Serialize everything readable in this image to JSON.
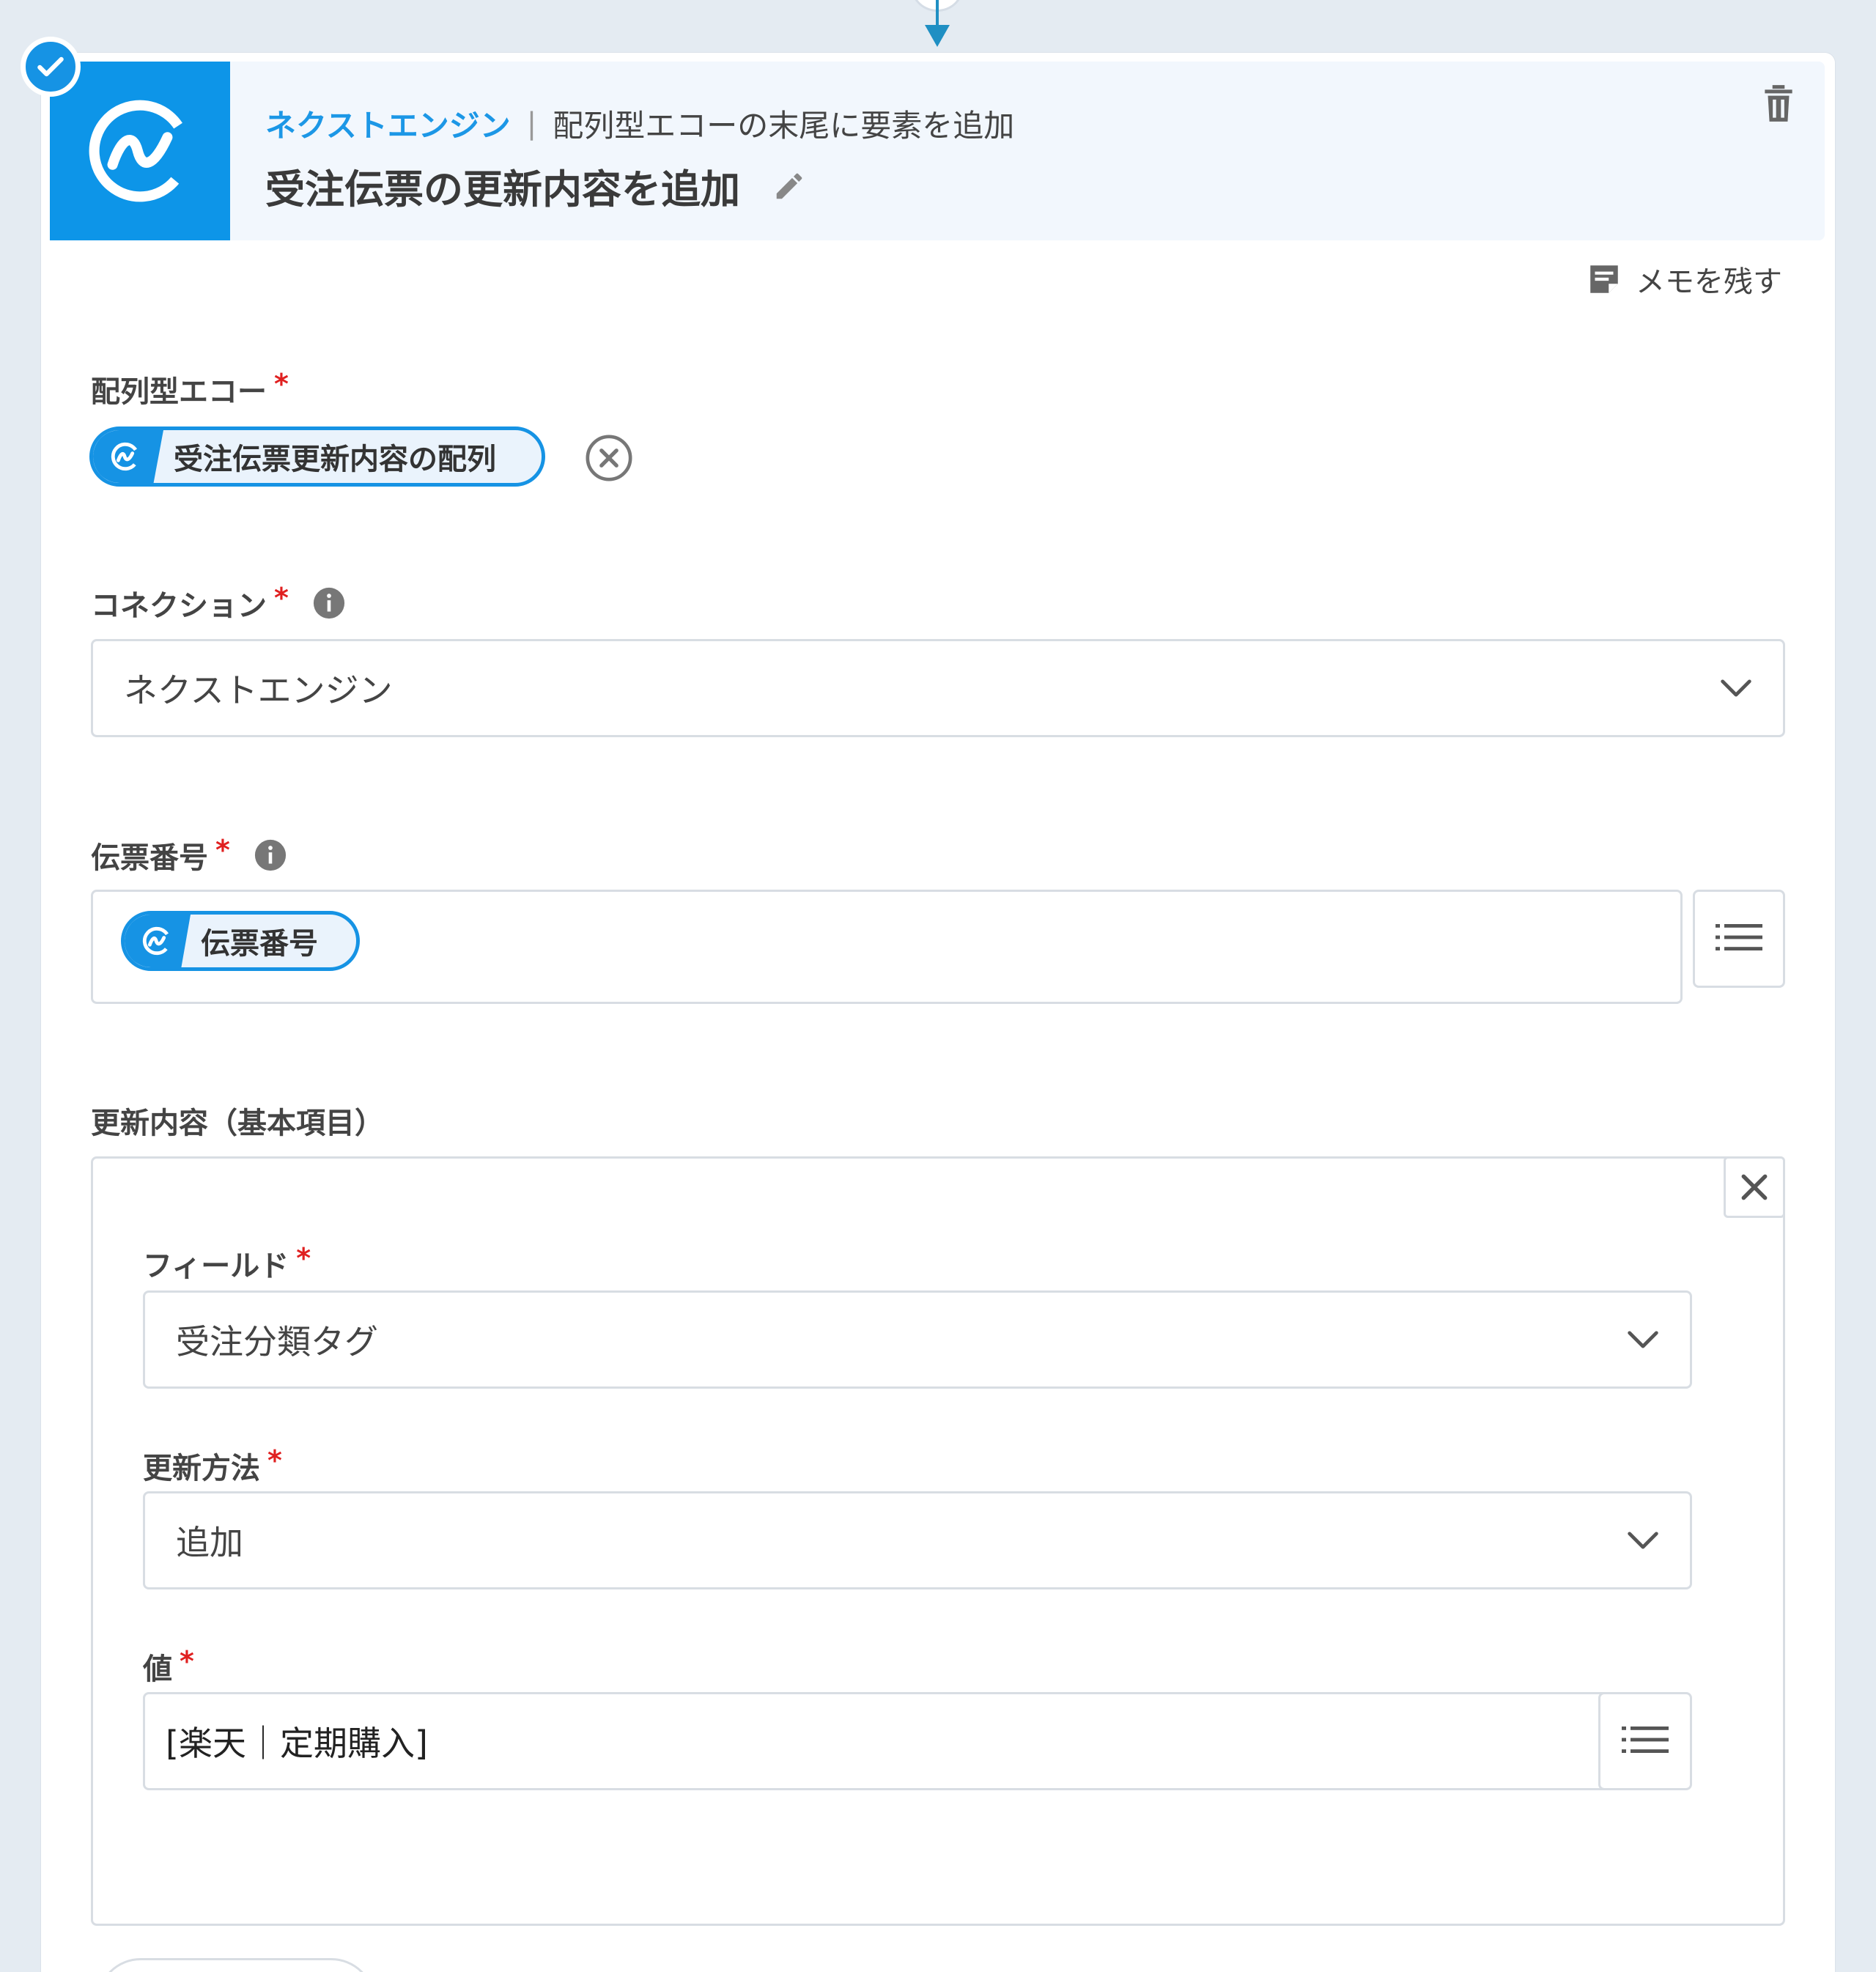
{
  "header": {
    "app_name": "ネクストエンジン",
    "separator": "|",
    "action_name": "配列型エコーの末尾に要素を追加",
    "step_title": "受注伝票の更新内容を追加"
  },
  "memo": {
    "label": "メモを残す"
  },
  "fields": {
    "array_echo": {
      "label": "配列型エコー",
      "required_mark": "*",
      "pill_value": "受注伝票更新内容の配列"
    },
    "connection": {
      "label": "コネクション",
      "required_mark": "*",
      "selected": "ネクストエンジン"
    },
    "slip_number": {
      "label": "伝票番号",
      "required_mark": "*",
      "pill_value": "伝票番号"
    },
    "update_content": {
      "label": "更新内容（基本項目）",
      "field": {
        "label": "フィールド",
        "required_mark": "*",
        "selected": "受注分類タグ"
      },
      "method": {
        "label": "更新方法",
        "required_mark": "*",
        "selected": "追加"
      },
      "value": {
        "label": "値",
        "required_mark": "*",
        "text": "[楽天｜定期購入]"
      }
    }
  },
  "colors": {
    "brand": "#1693e4",
    "required": "#e02020",
    "connector": "#1f8fc3"
  },
  "icons": [
    "check-icon",
    "next-engine-logo-icon",
    "pencil-icon",
    "trash-icon",
    "memo-icon",
    "info-icon",
    "chevron-down-icon",
    "list-icon",
    "close-icon",
    "circle-x-icon"
  ]
}
